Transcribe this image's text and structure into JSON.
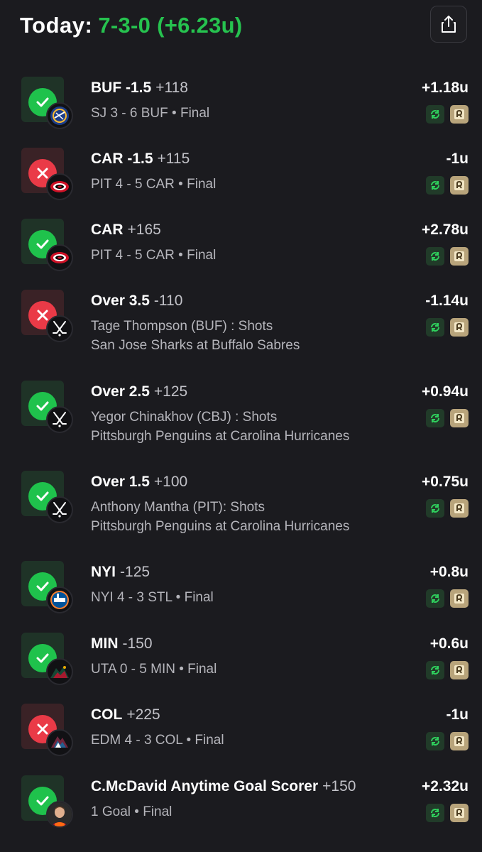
{
  "header": {
    "label": "Today:",
    "record": "7-3-0 (+6.23u)"
  },
  "share_icon": "share-icon",
  "colors": {
    "win": "#1fc24c",
    "loss": "#ea3a47",
    "record": "#26c24f"
  },
  "bets": [
    {
      "result": "win",
      "title": "BUF -1.5",
      "odds": "+118",
      "sub1": "SJ 3 - 6 BUF • Final",
      "sub2": "",
      "units": "+1.18u",
      "logo": "sabres-logo"
    },
    {
      "result": "loss",
      "title": "CAR -1.5",
      "odds": "+115",
      "sub1": "PIT 4 - 5 CAR • Final",
      "sub2": "",
      "units": "-1u",
      "logo": "hurricanes-logo"
    },
    {
      "result": "win",
      "title": "CAR",
      "odds": "+165",
      "sub1": "PIT 4 - 5 CAR • Final",
      "sub2": "",
      "units": "+2.78u",
      "logo": "hurricanes-logo"
    },
    {
      "result": "loss",
      "title": "Over 3.5",
      "odds": "-110",
      "sub1": "Tage Thompson (BUF) : Shots",
      "sub2": "San Jose Sharks at Buffalo Sabres",
      "units": "-1.14u",
      "logo": "hockey-sticks-icon"
    },
    {
      "result": "win",
      "title": "Over 2.5",
      "odds": "+125",
      "sub1": "Yegor Chinakhov (CBJ) : Shots",
      "sub2": "Pittsburgh Penguins at Carolina Hurricanes",
      "units": "+0.94u",
      "logo": "hockey-sticks-icon"
    },
    {
      "result": "win",
      "title": "Over 1.5",
      "odds": "+100",
      "sub1": "Anthony Mantha (PIT): Shots",
      "sub2": "Pittsburgh Penguins at Carolina Hurricanes",
      "units": "+0.75u",
      "logo": "hockey-sticks-icon"
    },
    {
      "result": "win",
      "title": "NYI",
      "odds": "-125",
      "sub1": "NYI 4 - 3 STL • Final",
      "sub2": "",
      "units": "+0.8u",
      "logo": "islanders-logo"
    },
    {
      "result": "win",
      "title": "MIN",
      "odds": "-150",
      "sub1": "UTA 0 - 5 MIN • Final",
      "sub2": "",
      "units": "+0.6u",
      "logo": "wild-logo"
    },
    {
      "result": "loss",
      "title": "COL",
      "odds": "+225",
      "sub1": "EDM 4 - 3 COL • Final",
      "sub2": "",
      "units": "-1u",
      "logo": "avalanche-logo"
    },
    {
      "result": "win",
      "title": "C.McDavid Anytime Goal Scorer",
      "odds": "+150",
      "sub1": "1 Goal • Final",
      "sub2": "",
      "units": "+2.32u",
      "logo": "player-headshot"
    }
  ]
}
